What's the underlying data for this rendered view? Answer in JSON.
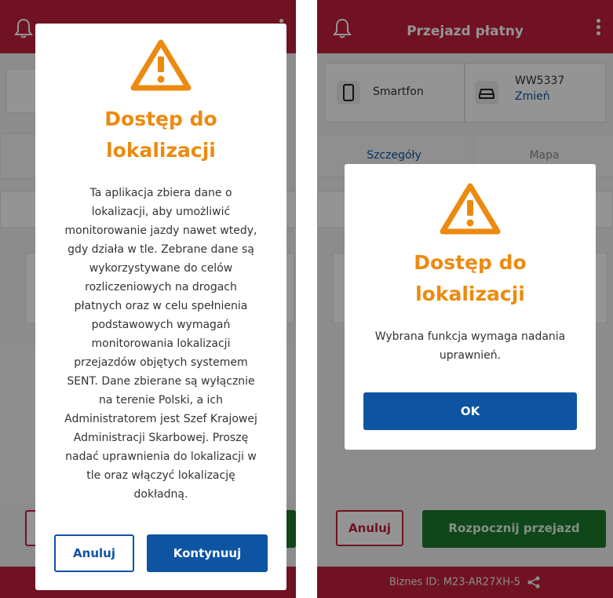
{
  "colors": {
    "brand_red": "#c2203c",
    "primary_blue": "#0d54a3",
    "warning_orange": "#ec8a0f",
    "start_green": "#1b7a2a"
  },
  "right_screen": {
    "header": {
      "title": "Przejazd płatny"
    },
    "device": {
      "label": "Smartfon",
      "icon": "smartphone-icon"
    },
    "vehicle": {
      "plate": "WW5337",
      "change_link": "Zmień",
      "icon": "car-icon"
    },
    "tabs": [
      {
        "label": "Szczegóły"
      },
      {
        "label": "Mapa"
      }
    ],
    "actions": {
      "cancel": "Anuluj",
      "start": "Rozpocznij przejazd"
    },
    "footer": {
      "business_id": "Biznes ID:  M23-AR27XH-5"
    }
  },
  "dialog_left": {
    "icon": "warning-icon",
    "title_line1": "Dostęp do",
    "title_line2": "lokalizacji",
    "body_lines": [
      "Ta aplikacja zbiera dane o",
      "lokalizacji, aby umożliwić",
      "monitorowanie jazdy nawet wtedy,",
      "gdy działa w tle. Zebrane dane są",
      "wykorzystywane do celów",
      "rozliczeniowych na drogach",
      "płatnych oraz w celu spełnienia",
      "podstawowych wymagań",
      "monitorowania lokalizacji",
      "przejazdów objętych systemem",
      "SENT. Dane zbierane są wyłącznie",
      "na terenie Polski, a ich",
      "Administratorem jest Szef Krajowej",
      "Administracji Skarbowej. Proszę",
      "nadać uprawnienia do lokalizacji w",
      "tle oraz włączyć lokalizację",
      "dokładną."
    ],
    "cancel_label": "Anuluj",
    "continue_label": "Kontynuuj"
  },
  "dialog_right": {
    "icon": "warning-icon",
    "title_line1": "Dostęp do",
    "title_line2": "lokalizacji",
    "body_line1": "Wybrana funkcja wymaga nadania",
    "body_line2": "uprawnień.",
    "ok_label": "OK"
  }
}
